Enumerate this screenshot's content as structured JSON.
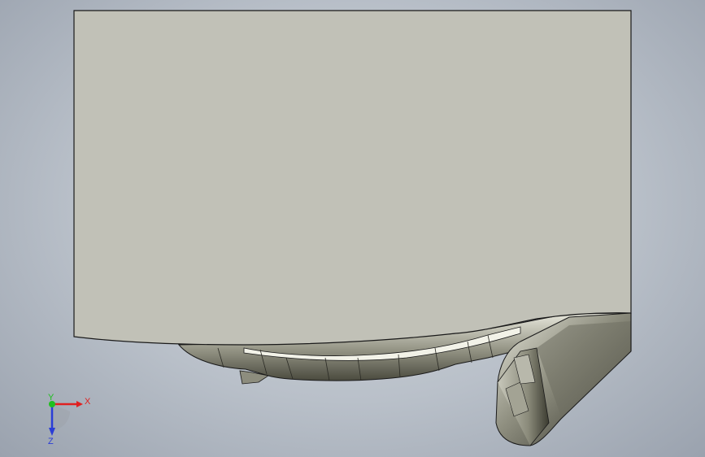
{
  "viewport": {
    "background_top": "#d4d9df",
    "background_edge": "#9aa2ae"
  },
  "model": {
    "face_color": "#c1c1b7",
    "edge_color": "#1a1a1a",
    "shadow_color": "#3a3a32",
    "highlight_color": "#f2f2e8"
  },
  "triad": {
    "x_label": "X",
    "y_label": "Y",
    "z_label": "Z",
    "x_color": "#e02020",
    "y_color": "#1fbf1f",
    "z_color": "#2a3dd6"
  }
}
